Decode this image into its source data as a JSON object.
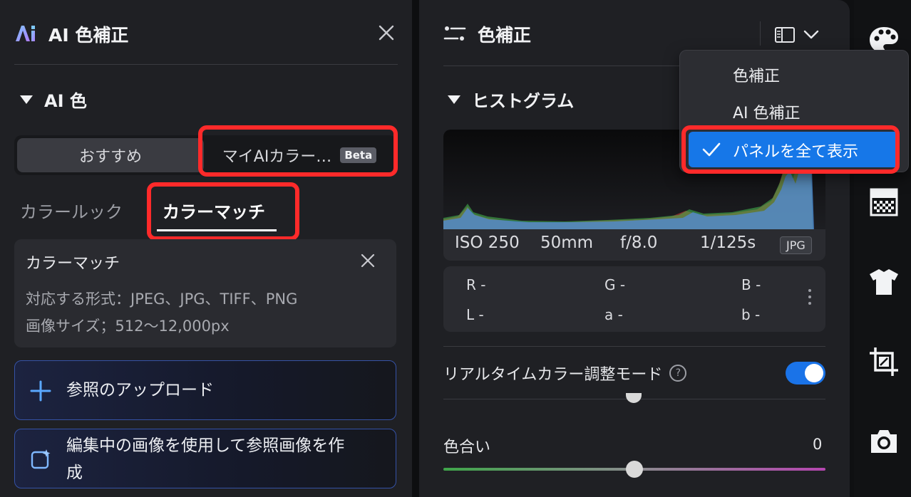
{
  "left_panel": {
    "title": "AI 色補正",
    "section_title": "AI 色",
    "segmented": {
      "recommended": "おすすめ",
      "my_ai_color": "マイAIカラー…",
      "beta": "Beta"
    },
    "tabs": [
      {
        "label": "カラールック",
        "active": false
      },
      {
        "label": "カラーマッチ",
        "active": true
      }
    ],
    "info_card": {
      "title": "カラーマッチ",
      "formats": "対応する形式：JPEG、JPG、TIFF、PNG",
      "size": "画像サイズ；512〜12,000px"
    },
    "upload_button": "参照のアップロード",
    "create_button_line1": "編集中の画像を使用して参照画像を作",
    "create_button_line2": "成"
  },
  "center_panel": {
    "title": "色補正",
    "histogram_title": "ヒストグラム",
    "exif": {
      "iso": "ISO 250",
      "focal": "50mm",
      "aperture": "f/8.0",
      "shutter": "1/125s",
      "format": "JPG"
    },
    "readout": {
      "r": "R -",
      "g": "G -",
      "b": "B -",
      "l": "L -",
      "a": "a -",
      "b2": "b -"
    },
    "realtime_label": "リアルタイムカラー調整モード",
    "realtime_on": true,
    "tint": {
      "label": "色合い",
      "value": "0",
      "value_fraction": 0.5
    }
  },
  "menu": {
    "items": [
      {
        "label": "色補正",
        "selected": false
      },
      {
        "label": "AI 色補正",
        "selected": false
      },
      {
        "label": "パネルを全て表示",
        "selected": true
      }
    ]
  },
  "colors": {
    "accent": "#1677e8",
    "highlight_box": "#ff2a2a",
    "toggle_on": "#1a73e8"
  },
  "icons": {
    "tools": [
      "palette-icon",
      "gradient-grid-icon",
      "tshirt-icon",
      "crop-icon",
      "camera-icon"
    ]
  }
}
